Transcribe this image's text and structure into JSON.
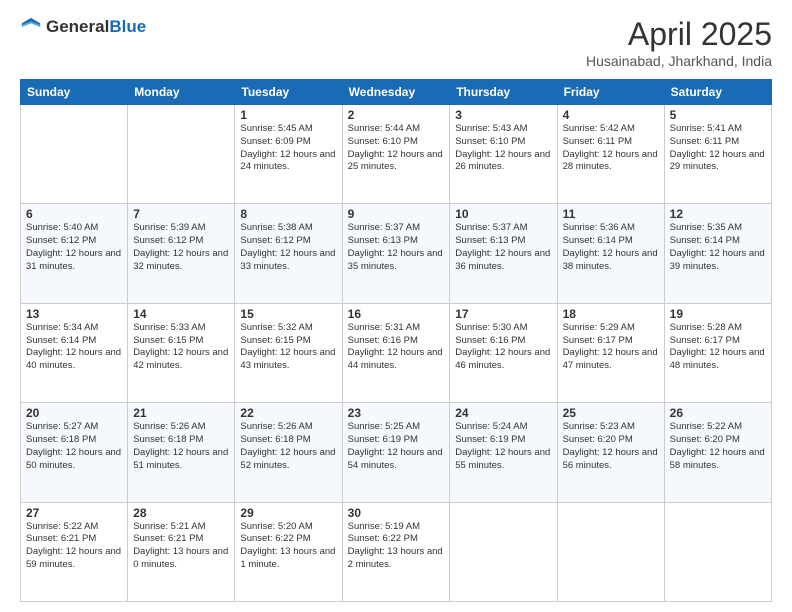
{
  "header": {
    "logo_general": "General",
    "logo_blue": "Blue",
    "title": "April 2025",
    "subtitle": "Husainabad, Jharkhand, India"
  },
  "days_of_week": [
    "Sunday",
    "Monday",
    "Tuesday",
    "Wednesday",
    "Thursday",
    "Friday",
    "Saturday"
  ],
  "weeks": [
    [
      {
        "day": "",
        "sunrise": "",
        "sunset": "",
        "daylight": ""
      },
      {
        "day": "",
        "sunrise": "",
        "sunset": "",
        "daylight": ""
      },
      {
        "day": "1",
        "sunrise": "Sunrise: 5:45 AM",
        "sunset": "Sunset: 6:09 PM",
        "daylight": "Daylight: 12 hours and 24 minutes."
      },
      {
        "day": "2",
        "sunrise": "Sunrise: 5:44 AM",
        "sunset": "Sunset: 6:10 PM",
        "daylight": "Daylight: 12 hours and 25 minutes."
      },
      {
        "day": "3",
        "sunrise": "Sunrise: 5:43 AM",
        "sunset": "Sunset: 6:10 PM",
        "daylight": "Daylight: 12 hours and 26 minutes."
      },
      {
        "day": "4",
        "sunrise": "Sunrise: 5:42 AM",
        "sunset": "Sunset: 6:11 PM",
        "daylight": "Daylight: 12 hours and 28 minutes."
      },
      {
        "day": "5",
        "sunrise": "Sunrise: 5:41 AM",
        "sunset": "Sunset: 6:11 PM",
        "daylight": "Daylight: 12 hours and 29 minutes."
      }
    ],
    [
      {
        "day": "6",
        "sunrise": "Sunrise: 5:40 AM",
        "sunset": "Sunset: 6:12 PM",
        "daylight": "Daylight: 12 hours and 31 minutes."
      },
      {
        "day": "7",
        "sunrise": "Sunrise: 5:39 AM",
        "sunset": "Sunset: 6:12 PM",
        "daylight": "Daylight: 12 hours and 32 minutes."
      },
      {
        "day": "8",
        "sunrise": "Sunrise: 5:38 AM",
        "sunset": "Sunset: 6:12 PM",
        "daylight": "Daylight: 12 hours and 33 minutes."
      },
      {
        "day": "9",
        "sunrise": "Sunrise: 5:37 AM",
        "sunset": "Sunset: 6:13 PM",
        "daylight": "Daylight: 12 hours and 35 minutes."
      },
      {
        "day": "10",
        "sunrise": "Sunrise: 5:37 AM",
        "sunset": "Sunset: 6:13 PM",
        "daylight": "Daylight: 12 hours and 36 minutes."
      },
      {
        "day": "11",
        "sunrise": "Sunrise: 5:36 AM",
        "sunset": "Sunset: 6:14 PM",
        "daylight": "Daylight: 12 hours and 38 minutes."
      },
      {
        "day": "12",
        "sunrise": "Sunrise: 5:35 AM",
        "sunset": "Sunset: 6:14 PM",
        "daylight": "Daylight: 12 hours and 39 minutes."
      }
    ],
    [
      {
        "day": "13",
        "sunrise": "Sunrise: 5:34 AM",
        "sunset": "Sunset: 6:14 PM",
        "daylight": "Daylight: 12 hours and 40 minutes."
      },
      {
        "day": "14",
        "sunrise": "Sunrise: 5:33 AM",
        "sunset": "Sunset: 6:15 PM",
        "daylight": "Daylight: 12 hours and 42 minutes."
      },
      {
        "day": "15",
        "sunrise": "Sunrise: 5:32 AM",
        "sunset": "Sunset: 6:15 PM",
        "daylight": "Daylight: 12 hours and 43 minutes."
      },
      {
        "day": "16",
        "sunrise": "Sunrise: 5:31 AM",
        "sunset": "Sunset: 6:16 PM",
        "daylight": "Daylight: 12 hours and 44 minutes."
      },
      {
        "day": "17",
        "sunrise": "Sunrise: 5:30 AM",
        "sunset": "Sunset: 6:16 PM",
        "daylight": "Daylight: 12 hours and 46 minutes."
      },
      {
        "day": "18",
        "sunrise": "Sunrise: 5:29 AM",
        "sunset": "Sunset: 6:17 PM",
        "daylight": "Daylight: 12 hours and 47 minutes."
      },
      {
        "day": "19",
        "sunrise": "Sunrise: 5:28 AM",
        "sunset": "Sunset: 6:17 PM",
        "daylight": "Daylight: 12 hours and 48 minutes."
      }
    ],
    [
      {
        "day": "20",
        "sunrise": "Sunrise: 5:27 AM",
        "sunset": "Sunset: 6:18 PM",
        "daylight": "Daylight: 12 hours and 50 minutes."
      },
      {
        "day": "21",
        "sunrise": "Sunrise: 5:26 AM",
        "sunset": "Sunset: 6:18 PM",
        "daylight": "Daylight: 12 hours and 51 minutes."
      },
      {
        "day": "22",
        "sunrise": "Sunrise: 5:26 AM",
        "sunset": "Sunset: 6:18 PM",
        "daylight": "Daylight: 12 hours and 52 minutes."
      },
      {
        "day": "23",
        "sunrise": "Sunrise: 5:25 AM",
        "sunset": "Sunset: 6:19 PM",
        "daylight": "Daylight: 12 hours and 54 minutes."
      },
      {
        "day": "24",
        "sunrise": "Sunrise: 5:24 AM",
        "sunset": "Sunset: 6:19 PM",
        "daylight": "Daylight: 12 hours and 55 minutes."
      },
      {
        "day": "25",
        "sunrise": "Sunrise: 5:23 AM",
        "sunset": "Sunset: 6:20 PM",
        "daylight": "Daylight: 12 hours and 56 minutes."
      },
      {
        "day": "26",
        "sunrise": "Sunrise: 5:22 AM",
        "sunset": "Sunset: 6:20 PM",
        "daylight": "Daylight: 12 hours and 58 minutes."
      }
    ],
    [
      {
        "day": "27",
        "sunrise": "Sunrise: 5:22 AM",
        "sunset": "Sunset: 6:21 PM",
        "daylight": "Daylight: 12 hours and 59 minutes."
      },
      {
        "day": "28",
        "sunrise": "Sunrise: 5:21 AM",
        "sunset": "Sunset: 6:21 PM",
        "daylight": "Daylight: 13 hours and 0 minutes."
      },
      {
        "day": "29",
        "sunrise": "Sunrise: 5:20 AM",
        "sunset": "Sunset: 6:22 PM",
        "daylight": "Daylight: 13 hours and 1 minute."
      },
      {
        "day": "30",
        "sunrise": "Sunrise: 5:19 AM",
        "sunset": "Sunset: 6:22 PM",
        "daylight": "Daylight: 13 hours and 2 minutes."
      },
      {
        "day": "",
        "sunrise": "",
        "sunset": "",
        "daylight": ""
      },
      {
        "day": "",
        "sunrise": "",
        "sunset": "",
        "daylight": ""
      },
      {
        "day": "",
        "sunrise": "",
        "sunset": "",
        "daylight": ""
      }
    ]
  ]
}
